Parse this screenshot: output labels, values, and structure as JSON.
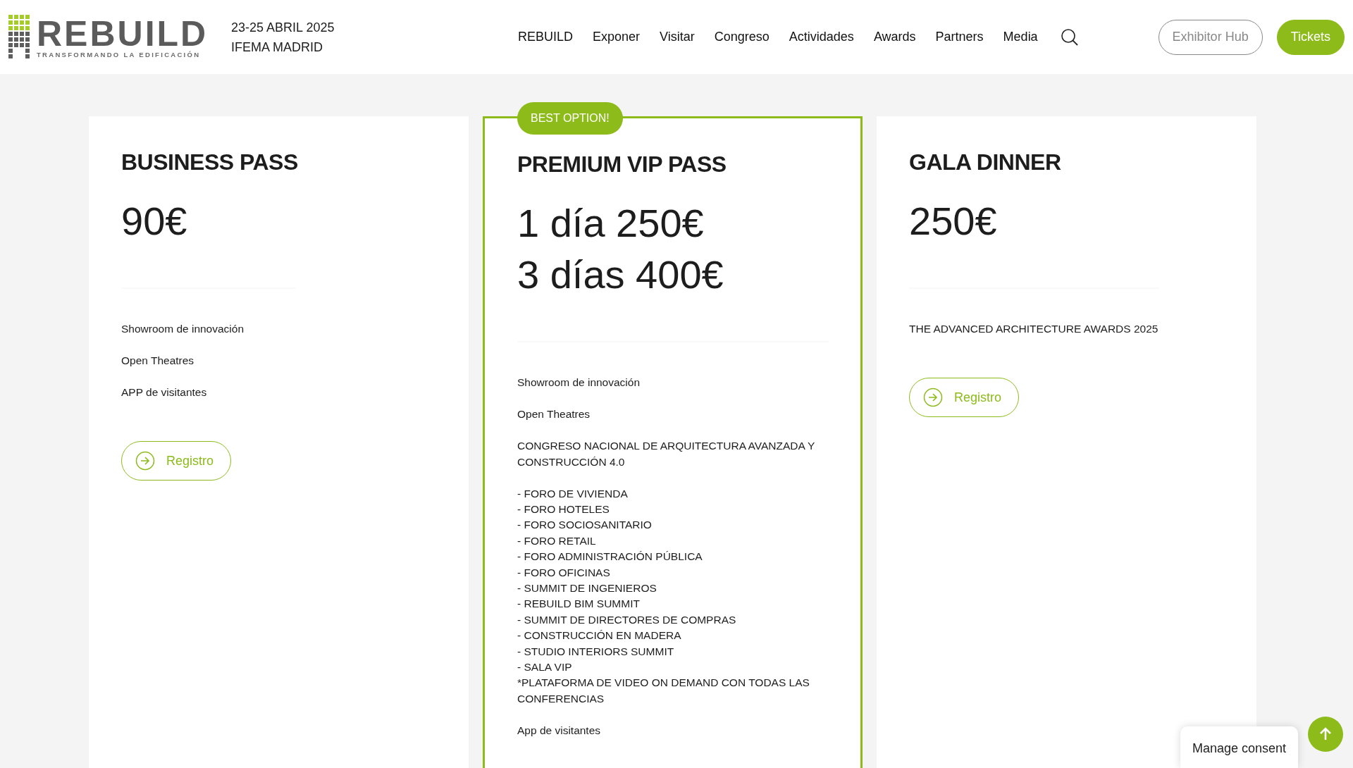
{
  "header": {
    "logo": {
      "name": "REBUILD",
      "tagline": "TRANSFORMANDO LA EDIFICACIÓN"
    },
    "dates": "23-25 ABRIL 2025",
    "venue": "IFEMA MADRID",
    "nav": [
      "REBUILD",
      "Exponer",
      "Visitar",
      "Congreso",
      "Actividades",
      "Awards",
      "Partners",
      "Media"
    ],
    "buttons": [
      {
        "label": "Exhibitor Hub",
        "kind": "outline"
      },
      {
        "label": "Tickets",
        "kind": "filled"
      }
    ]
  },
  "plans": [
    {
      "title": "BUSINESS PASS",
      "featured": false,
      "prices": [
        "90€"
      ],
      "features": [
        [
          "Showroom de innovación"
        ],
        [
          "Open Theatres"
        ],
        [
          "APP de visitantes"
        ]
      ],
      "button": "Registro"
    },
    {
      "title": "PREMIUM VIP PASS",
      "featured": true,
      "badge": "BEST OPTION!",
      "prices": [
        "1 día 250€",
        "3 días 400€"
      ],
      "features": [
        [
          "Showroom de innovación"
        ],
        [
          "Open Theatres"
        ],
        [
          "CONGRESO NACIONAL DE ARQUITECTURA AVANZADA Y CONSTRUCCIÓN 4.0"
        ],
        [
          "- FORO DE VIVIENDA",
          "- FORO HOTELES",
          "- FORO SOCIOSANITARIO",
          "- FORO RETAIL",
          "- FORO ADMINISTRACIÓN PÚBLICA",
          "- FORO OFICINAS",
          "- SUMMIT DE INGENIEROS",
          "- REBUILD BIM SUMMIT",
          "- SUMMIT DE DIRECTORES DE COMPRAS",
          "- CONSTRUCCIÓN EN MADERA",
          "- STUDIO INTERIORS SUMMIT",
          "- SALA VIP",
          "*PLATAFORMA DE VIDEO ON DEMAND CON TODAS LAS CONFERENCIAS"
        ],
        [
          "App de visitantes"
        ]
      ]
    },
    {
      "title": "GALA DINNER",
      "featured": false,
      "prices": [
        "250€"
      ],
      "features": [
        [
          "THE ADVANCED ARCHITECTURE AWARDS 2025"
        ]
      ],
      "button": "Registro"
    }
  ],
  "consent": "Manage consent"
}
